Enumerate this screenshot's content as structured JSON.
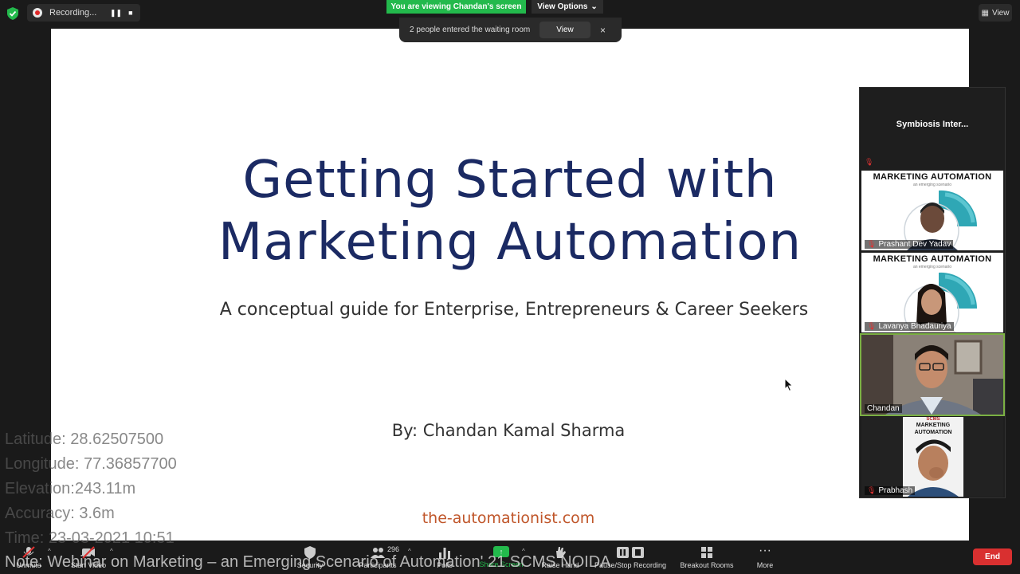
{
  "recording": {
    "label": "Recording..."
  },
  "banner": {
    "viewing": "You are viewing Chandan's screen",
    "view_options": "View Options",
    "view_top": "View"
  },
  "toast": {
    "text": "2 people entered the waiting room",
    "view": "View",
    "close": "×"
  },
  "slide": {
    "title_line1": "Getting Started with",
    "title_line2": "Marketing Automation",
    "subtitle": "A conceptual guide for Enterprise, Entrepreneurs & Career Seekers",
    "byline": "By: Chandan Kamal Sharma",
    "url": "the-automationist.com"
  },
  "participants": [
    {
      "name": "Symbiosis  Inter...",
      "type": "name-only"
    },
    {
      "name": "Prashant Dev Yadav",
      "slide_head": "MARKETING AUTOMATION",
      "slide_sub": "an emerging scenario"
    },
    {
      "name": "Lavanya Bhadauriya",
      "slide_head": "MARKETING AUTOMATION",
      "slide_sub": "an emerging scenario"
    },
    {
      "name": "Chandan"
    },
    {
      "name": "Prabhash",
      "slide_head": "MARKETING AUTOMATION"
    }
  ],
  "toolbar": {
    "unmute": "Unmute",
    "start_video": "Start Video",
    "security": "Security",
    "participants": "Participants",
    "participants_count": "296",
    "polls": "Polls",
    "share_screen": "Share Screen",
    "raise_hand": "Raise Hand",
    "pause_stop": "Pause/Stop Recording",
    "breakout": "Breakout Rooms",
    "more": "More",
    "end": "End"
  },
  "gps": {
    "latitude": "Latitude: 28.62507500",
    "longitude": "Longitude: 77.36857700",
    "elevation": "Elevation:243.11m",
    "accuracy": "Accuracy: 3.6m",
    "time": "Time: 23-03-2021  10:51",
    "note": "Note: Webinar on Marketing – an Emerging Scenario of Automation' 21 SCMS NOIDA"
  },
  "colors": {
    "accent_green": "#23b94c",
    "end_red": "#d93030",
    "slide_title": "#1b2a63",
    "url_orange": "#c0562a"
  }
}
